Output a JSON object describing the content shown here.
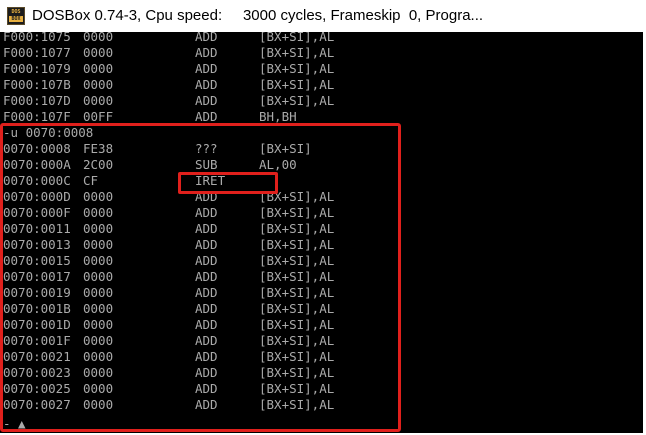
{
  "window": {
    "title": "DOSBox 0.74-3, Cpu speed:     3000 cycles, Frameskip  0, Progra...",
    "icon_top": "DOS",
    "icon_bottom": "BOX"
  },
  "console": {
    "lines": [
      {
        "addr": "F000:1075",
        "hex": "0000",
        "mnemonic": "ADD",
        "operands": "[BX+SI],AL"
      },
      {
        "addr": "F000:1077",
        "hex": "0000",
        "mnemonic": "ADD",
        "operands": "[BX+SI],AL"
      },
      {
        "addr": "F000:1079",
        "hex": "0000",
        "mnemonic": "ADD",
        "operands": "[BX+SI],AL"
      },
      {
        "addr": "F000:107B",
        "hex": "0000",
        "mnemonic": "ADD",
        "operands": "[BX+SI],AL"
      },
      {
        "addr": "F000:107D",
        "hex": "0000",
        "mnemonic": "ADD",
        "operands": "[BX+SI],AL"
      },
      {
        "addr": "F000:107F",
        "hex": "00FF",
        "mnemonic": "ADD",
        "operands": "BH,BH"
      },
      {
        "command": "-u 0070:0008"
      },
      {
        "addr": "0070:0008",
        "hex": "FE38",
        "mnemonic": "???",
        "operands": "[BX+SI]"
      },
      {
        "addr": "0070:000A",
        "hex": "2C00",
        "mnemonic": "SUB",
        "operands": "AL,00"
      },
      {
        "addr": "0070:000C",
        "hex": "CF",
        "mnemonic": "IRET",
        "operands": ""
      },
      {
        "addr": "0070:000D",
        "hex": "0000",
        "mnemonic": "ADD",
        "operands": "[BX+SI],AL"
      },
      {
        "addr": "0070:000F",
        "hex": "0000",
        "mnemonic": "ADD",
        "operands": "[BX+SI],AL"
      },
      {
        "addr": "0070:0011",
        "hex": "0000",
        "mnemonic": "ADD",
        "operands": "[BX+SI],AL"
      },
      {
        "addr": "0070:0013",
        "hex": "0000",
        "mnemonic": "ADD",
        "operands": "[BX+SI],AL"
      },
      {
        "addr": "0070:0015",
        "hex": "0000",
        "mnemonic": "ADD",
        "operands": "[BX+SI],AL"
      },
      {
        "addr": "0070:0017",
        "hex": "0000",
        "mnemonic": "ADD",
        "operands": "[BX+SI],AL"
      },
      {
        "addr": "0070:0019",
        "hex": "0000",
        "mnemonic": "ADD",
        "operands": "[BX+SI],AL"
      },
      {
        "addr": "0070:001B",
        "hex": "0000",
        "mnemonic": "ADD",
        "operands": "[BX+SI],AL"
      },
      {
        "addr": "0070:001D",
        "hex": "0000",
        "mnemonic": "ADD",
        "operands": "[BX+SI],AL"
      },
      {
        "addr": "0070:001F",
        "hex": "0000",
        "mnemonic": "ADD",
        "operands": "[BX+SI],AL"
      },
      {
        "addr": "0070:0021",
        "hex": "0000",
        "mnemonic": "ADD",
        "operands": "[BX+SI],AL"
      },
      {
        "addr": "0070:0023",
        "hex": "0000",
        "mnemonic": "ADD",
        "operands": "[BX+SI],AL"
      },
      {
        "addr": "0070:0025",
        "hex": "0000",
        "mnemonic": "ADD",
        "operands": "[BX+SI],AL"
      },
      {
        "addr": "0070:0027",
        "hex": "0000",
        "mnemonic": "ADD",
        "operands": "[BX+SI],AL"
      }
    ],
    "prompt": "- ▲"
  },
  "colors": {
    "console_bg": "#000000",
    "console_text": "#aaaaaa",
    "annotation": "#e0201c"
  }
}
